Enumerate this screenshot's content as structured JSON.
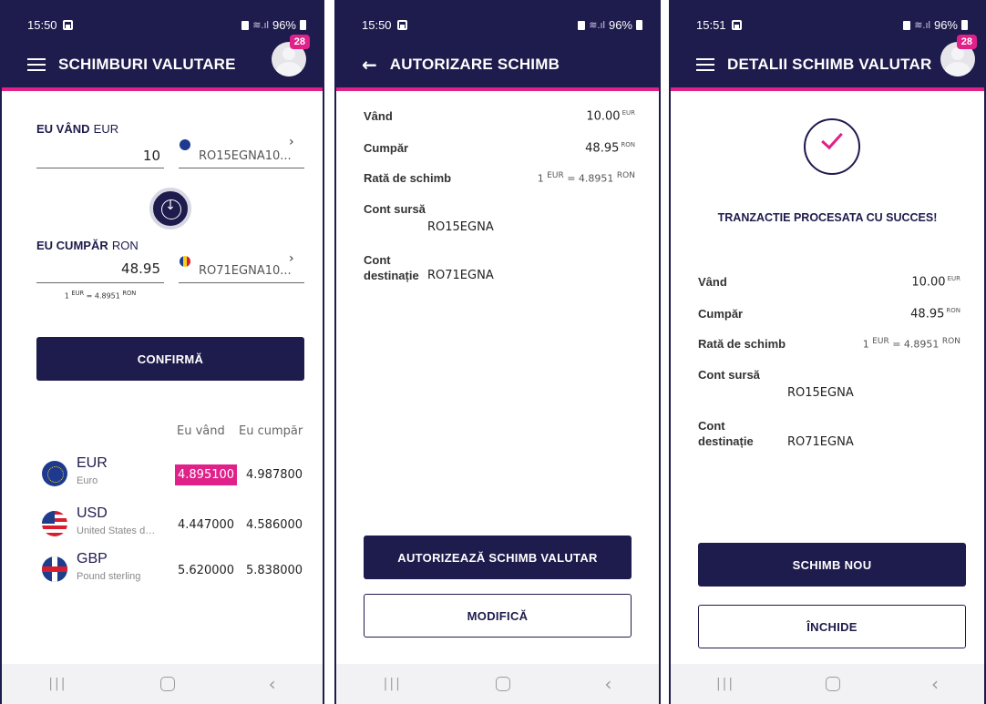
{
  "status": {
    "screen1_time": "15:50",
    "screen2_time": "15:50",
    "screen3_time": "15:51",
    "battery": "96%"
  },
  "screen1": {
    "title": "SCHIMBURI VALUTARE",
    "notif_count": "28",
    "sell_label_bold": "EU VÂND",
    "sell_currency": "EUR",
    "sell_amount": "10",
    "sell_account": "RO15EGNA10...",
    "buy_label_bold": "EU CUMPĂR",
    "buy_currency": "RON",
    "buy_amount": "48.95",
    "buy_account": "RO71EGNA10...",
    "rate_prefix": "1",
    "rate_from": "EUR",
    "rate_value": "= 4.8951",
    "rate_to": "RON",
    "confirm_label": "CONFIRMĂ",
    "col_sell": "Eu vând",
    "col_buy": "Eu cumpăr",
    "currencies": [
      {
        "code": "EUR",
        "name": "Euro",
        "sell": "4.895100",
        "buy": "4.987800",
        "flag": "eu-flag-icon"
      },
      {
        "code": "USD",
        "name": "United States do...",
        "sell": "4.447000",
        "buy": "4.586000",
        "flag": "us-flag-icon"
      },
      {
        "code": "GBP",
        "name": "Pound sterling",
        "sell": "5.620000",
        "buy": "5.838000",
        "flag": "gb-flag-icon"
      }
    ]
  },
  "screen2": {
    "title": "AUTORIZARE SCHIMB",
    "sell_label": "Vând",
    "sell_value": "10.00",
    "sell_unit": "EUR",
    "buy_label": "Cumpăr",
    "buy_value": "48.95",
    "buy_unit": "RON",
    "rate_label": "Rată de schimb",
    "rate_text_1": "1",
    "rate_from": "EUR",
    "rate_text_2": "= 4.8951",
    "rate_to": "RON",
    "source_label": "Cont sursă",
    "source_value": "RO15EGNA",
    "dest_label_1": "Cont",
    "dest_label_2": "destinație",
    "dest_value": "RO71EGNA",
    "authorize_label": "AUTORIZEAZĂ SCHIMB VALUTAR",
    "modify_label": "MODIFICĂ"
  },
  "screen3": {
    "title": "DETALII SCHIMB VALUTAR",
    "notif_count": "28",
    "success_text": "TRANZACTIE PROCESATA CU SUCCES!",
    "sell_label": "Vând",
    "sell_value": "10.00",
    "sell_unit": "EUR",
    "buy_label": "Cumpăr",
    "buy_value": "48.95",
    "buy_unit": "RON",
    "rate_label": "Rată de schimb",
    "rate_text_1": "1",
    "rate_from": "EUR",
    "rate_text_2": "= 4.8951",
    "rate_to": "RON",
    "source_label": "Cont sursă",
    "source_value": "RO15EGNA",
    "dest_label_1": "Cont",
    "dest_label_2": "destinație",
    "dest_value": "RO71EGNA",
    "new_exchange_label": "SCHIMB NOU",
    "close_label": "ÎNCHIDE"
  },
  "colors": {
    "primary": "#1e1b4d",
    "accent": "#e0218a"
  },
  "icons": [
    "menu-icon",
    "back-arrow-icon",
    "avatar",
    "swap-arrow-icon",
    "chevron-right-icon",
    "success-check-icon"
  ]
}
